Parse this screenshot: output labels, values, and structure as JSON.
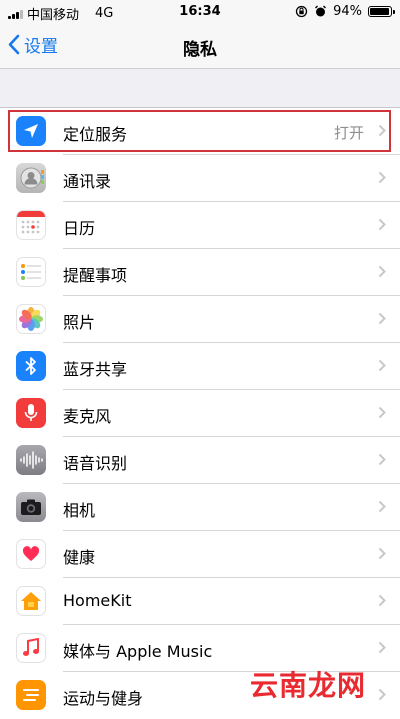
{
  "status_bar": {
    "carrier": "中国移动",
    "network": "4G",
    "time": "16:34",
    "battery": "94%",
    "battery_level": 0.94
  },
  "nav": {
    "back_label": "设置",
    "title": "隐私"
  },
  "list": {
    "items": [
      {
        "label": "定位服务",
        "detail": "打开",
        "icon": "location-arrow-icon",
        "color": "#1a82fb"
      },
      {
        "label": "通讯录",
        "icon": "contacts-icon",
        "color": "#c9c9c9"
      },
      {
        "label": "日历",
        "icon": "calendar-icon",
        "color": "#ffffff"
      },
      {
        "label": "提醒事项",
        "icon": "reminders-icon",
        "color": "#ffffff"
      },
      {
        "label": "照片",
        "icon": "photos-icon",
        "color": "#ffffff"
      },
      {
        "label": "蓝牙共享",
        "icon": "bluetooth-icon",
        "color": "#1a82fb"
      },
      {
        "label": "麦克风",
        "icon": "microphone-icon",
        "color": "#f23b3b"
      },
      {
        "label": "语音识别",
        "icon": "waveform-icon",
        "color": "#8e8e93"
      },
      {
        "label": "相机",
        "icon": "camera-icon",
        "color": "#8e8e93"
      },
      {
        "label": "健康",
        "icon": "heart-icon",
        "color": "#ffffff"
      },
      {
        "label": "HomeKit",
        "icon": "home-icon",
        "color": "#ffffff"
      },
      {
        "label": "媒体与 Apple Music",
        "icon": "music-note-icon",
        "color": "#ffffff"
      },
      {
        "label": "运动与健身",
        "icon": "fitness-icon",
        "color": "#ff9500"
      }
    ]
  },
  "watermark": "云南龙网"
}
